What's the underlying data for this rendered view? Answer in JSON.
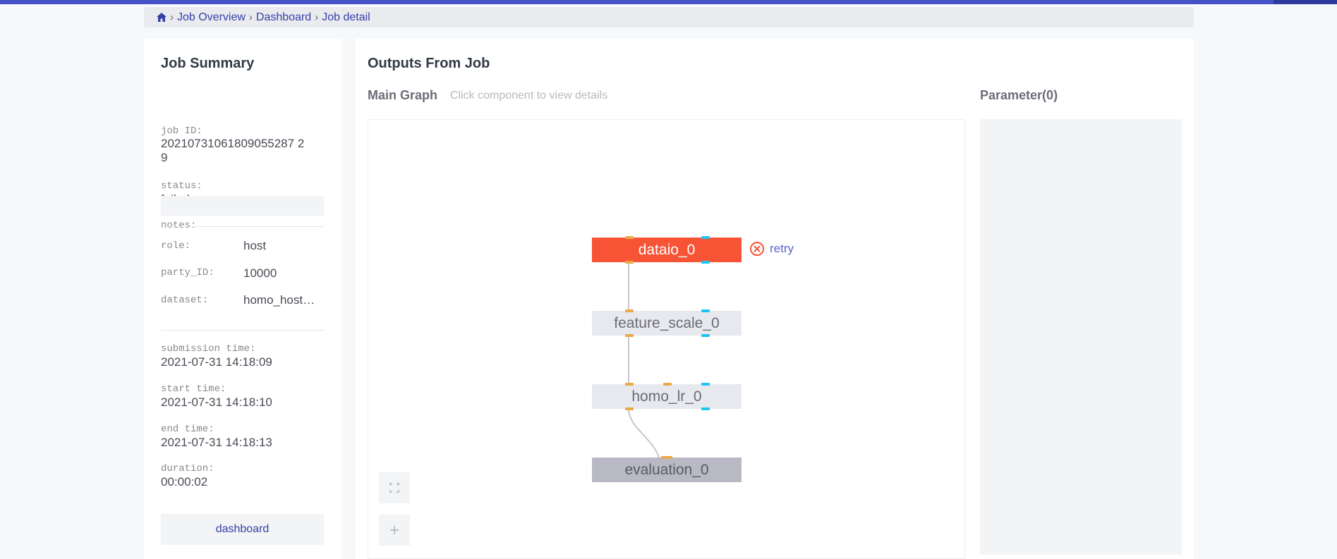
{
  "breadcrumb": {
    "items": [
      "Job Overview",
      "Dashboard",
      "Job detail"
    ]
  },
  "summary": {
    "title": "Job Summary",
    "job_id_label": "job ID:",
    "job_id_line1": "20210731061809055287 2",
    "job_id_line2": "9",
    "status_label": "status:",
    "status_value": "failed",
    "notes_label": "notes:",
    "role_label": "role:",
    "role_value": "host",
    "party_id_label": "party_ID:",
    "party_id_value": "10000",
    "dataset_label": "dataset:",
    "dataset_value": "homo_host…",
    "submission_label": "submission time:",
    "submission_value": "2021-07-31 14:18:09",
    "start_label": "start time:",
    "start_value": "2021-07-31 14:18:10",
    "end_label": "end time:",
    "end_value": "2021-07-31 14:18:13",
    "duration_label": "duration:",
    "duration_value": "00:00:02",
    "dashboard_button": "dashboard"
  },
  "outputs": {
    "title": "Outputs From Job",
    "main_graph_title": "Main Graph",
    "main_graph_hint": "Click component to view details",
    "parameter_title": "Parameter(0)",
    "retry_label": "retry"
  },
  "graph": {
    "nodes": [
      {
        "label": "dataio_0",
        "status": "failed"
      },
      {
        "label": "feature_scale_0",
        "status": "normal"
      },
      {
        "label": "homo_lr_0",
        "status": "normal"
      },
      {
        "label": "evaluation_0",
        "status": "evaluation"
      }
    ]
  },
  "colors": {
    "accent": "#4452c8",
    "failed_node": "#f75436",
    "link": "#3540a8",
    "data_port": "#e9a94a",
    "model_port": "#1ec4f4"
  },
  "icons": {
    "home": "home-icon",
    "retry": "error-circle-icon",
    "fullscreen": "fullscreen-icon",
    "zoom_in": "plus-icon"
  }
}
